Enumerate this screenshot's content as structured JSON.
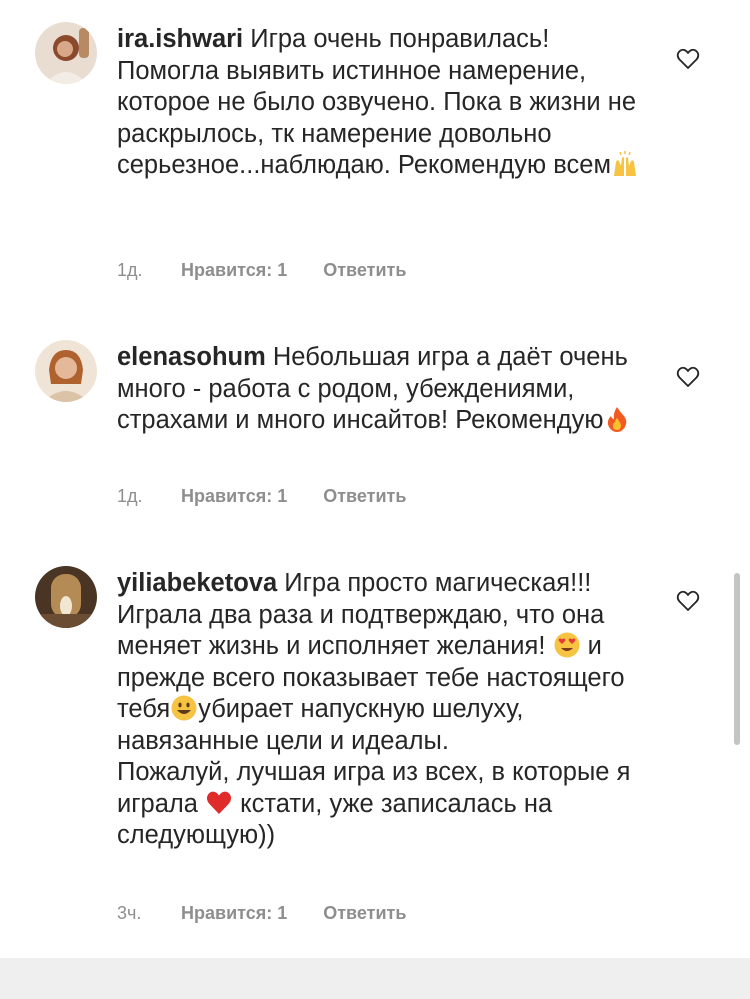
{
  "comments": [
    {
      "username": "ira.ishwari",
      "text_before": "Игра очень понравилась! Помогла выявить истинное намерение, которое не было озвучено. Пока в жизни не раскрылось, тк намерение довольно серьезное...наблюдаю. Рекомендую всем",
      "emoji": "raising-hands-emoji",
      "time": "1д.",
      "likes": "Нравится: 1",
      "reply": "Ответить"
    },
    {
      "username": "elenasohum",
      "text_before": "Небольшая игра а даёт очень много - работа с родом, убеждениями, страхами и много инсайтов! Рекомендую",
      "emoji": "fire-emoji",
      "time": "1д.",
      "likes": "Нравится: 1",
      "reply": "Ответить"
    },
    {
      "username": "yiliabeketova",
      "part1": "Игра просто магическая!!! Играла два раза и подтверждаю, что она меняет жизнь и исполняет желания!",
      "part2": " и прежде всего показывает тебе настоящего тебя",
      "part3": "убирает напускную шелуху, навязанные цели и идеалы.",
      "part4": "Пожалуй, лучшая игра из всех, в которые я играла",
      "part5": " кстати, уже записалась на следующую))",
      "emojis": [
        "heart-eyes-emoji",
        "smiley-emoji",
        "red-heart-emoji"
      ],
      "time": "3ч.",
      "likes": "Нравится: 1",
      "reply": "Ответить"
    }
  ],
  "colors": {
    "text": "#262626",
    "secondary": "#8e8e8e",
    "background": "#ffffff"
  }
}
